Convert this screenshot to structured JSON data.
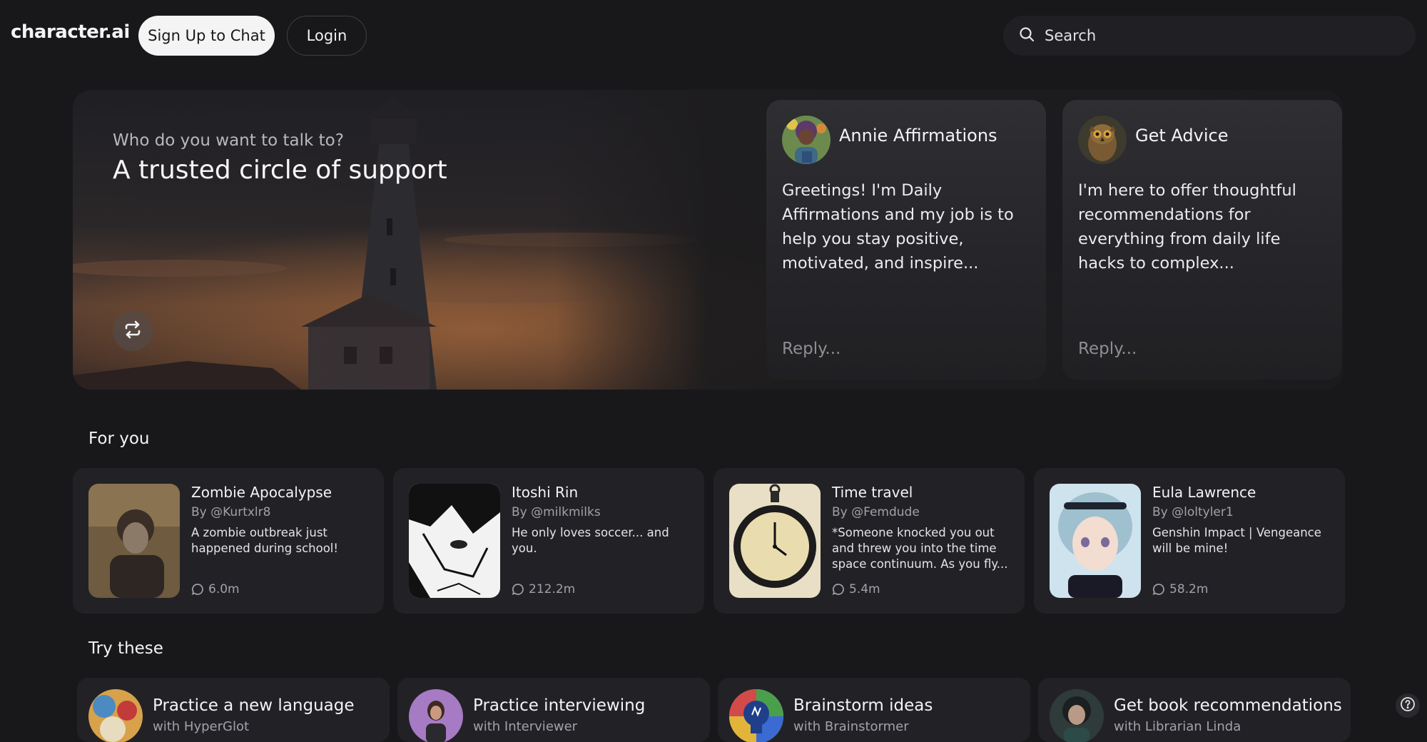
{
  "header": {
    "logo": "character.ai",
    "signup_label": "Sign Up to Chat",
    "login_label": "Login",
    "search_label": "Search"
  },
  "hero": {
    "subtitle": "Who do you want to talk to?",
    "title": "A trusted circle of support",
    "chats": [
      {
        "name": "Annie Affirmations",
        "message": "Greetings! I'm Daily Affirmations and my job is to help you stay positive, motivated, and inspire...",
        "reply_placeholder": "Reply..."
      },
      {
        "name": "Get Advice",
        "message": "I'm here to offer thoughtful recommendations for everything from daily life hacks to complex...",
        "reply_placeholder": "Reply..."
      }
    ]
  },
  "for_you": {
    "title": "For you",
    "cards": [
      {
        "title": "Zombie Apocalypse",
        "by": "By @Kurtxlr8",
        "desc": "A zombie outbreak just happened during school!",
        "count": "6.0m"
      },
      {
        "title": "Itoshi Rin",
        "by": "By @milkmilks",
        "desc": "He only loves soccer... and you.",
        "count": "212.2m"
      },
      {
        "title": "Time travel",
        "by": "By @Femdude",
        "desc": "*Someone knocked you out and threw you into the time space continuum. As you fly...",
        "count": "5.4m"
      },
      {
        "title": "Eula Lawrence",
        "by": "By @loltyler1",
        "desc": "Genshin Impact | Vengeance will be mine!",
        "count": "58.2m"
      }
    ]
  },
  "try_these": {
    "title": "Try these",
    "cards": [
      {
        "label": "Practice a new language",
        "sub": "with HyperGlot"
      },
      {
        "label": "Practice interviewing",
        "sub": "with Interviewer"
      },
      {
        "label": "Brainstorm ideas",
        "sub": "with Brainstormer"
      },
      {
        "label": "Get book recommendations",
        "sub": "with Librarian Linda"
      }
    ]
  },
  "icons": {
    "search": "search-icon",
    "refresh": "refresh-icon",
    "chat": "chat-bubble-icon",
    "help": "help-icon"
  },
  "colors": {
    "background": "#18181b",
    "card": "#222226",
    "primary_button": "#f4f4f5"
  }
}
